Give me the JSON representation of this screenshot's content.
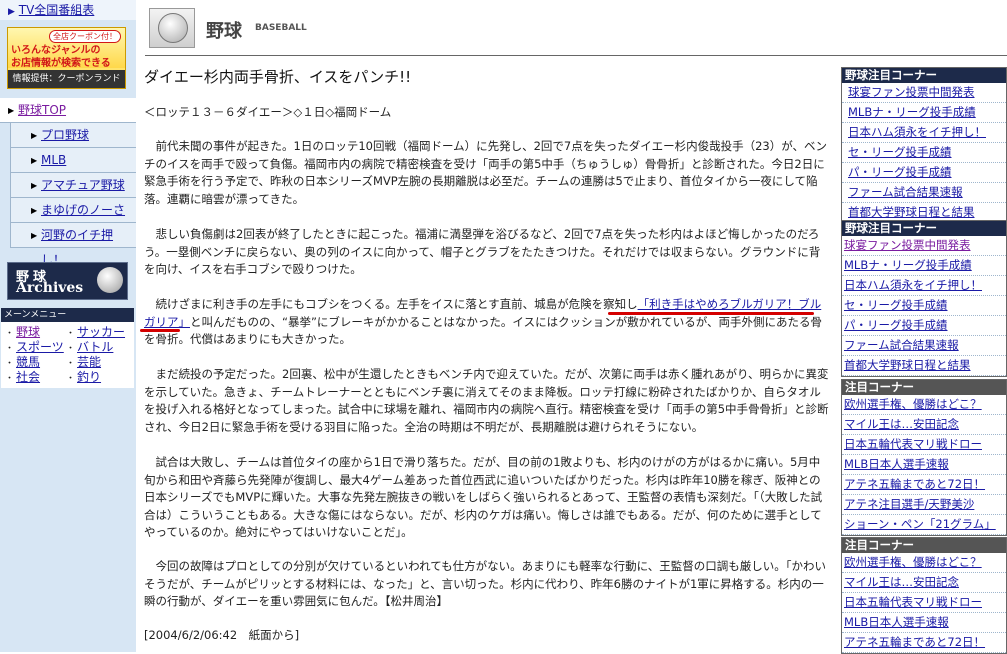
{
  "sidebar": {
    "tv_link": "TV全国番組表",
    "coupon_banner": {
      "badge": "全店クーポン付！",
      "line1": "いろんなジャンルの",
      "line2": "お店情報が検索できる",
      "footer": "情報提供：クーポンランド"
    },
    "nav": [
      {
        "label": "野球TOP"
      },
      {
        "label": "プロ野球"
      },
      {
        "label": "MLB"
      },
      {
        "label": "アマチュア野球"
      },
      {
        "label": "まゆげのノーさん"
      },
      {
        "label": "河野のイチ押し！"
      }
    ],
    "archives_banner": {
      "jp": "野球",
      "en": "Archives"
    },
    "menu_title": "メーンメニュー",
    "menu": [
      "野球",
      "サッカー",
      "スポーツ",
      "バトル",
      "競馬",
      "芸能",
      "社会",
      "釣り"
    ]
  },
  "header": {
    "title": "野球",
    "subtitle": "BASEBALL"
  },
  "article": {
    "headline": "ダイエー杉内両手骨折、イスをパンチ!!",
    "game": "＜ロッテ１３－６ダイエー＞◇１日◇福岡ドーム",
    "p1": "　前代未聞の事件が起きた。1日のロッテ10回戦（福岡ドーム）に先発し、2回で7点を失ったダイエー杉内俊哉投手（23）が、ベンチのイスを両手で殴って負傷。福岡市内の病院で精密検査を受け「両手の第5中手（ちゅうしゅ）骨骨折」と診断された。今日2日に緊急手術を行う予定で、昨秋の日本シリーズMVP左腕の長期離脱は必至だ。チームの連勝は5で止まり、首位タイから一夜にして陥落。連覇に暗雲が漂ってきた。",
    "p2": "　悲しい負傷劇は2回表が終了したときに起こった。福浦に満塁弾を浴びるなど、2回で7点を失った杉内はよほど悔しかったのだろう。一塁側ベンチに戻らない、奥の列のイスに向かって、帽子とグラブをたたきつけた。それだけでは収まらない。グラウンドに背を向け、イスを右手コブシで殴りつけた。",
    "p3_before": "　続けざまに利き手の左手にもコブシをつくる。左手をイスに落とす直前、城島が危険を察知し",
    "p3_highlight": "「利き手はやめろブルガリア！ブルガリア」",
    "p3_after": "と叫んだものの、“暴挙”にブレーキがかかることはなかった。イスにはクッションが敷かれているが、両手外側にあたる骨を骨折。代償はあまりにも大きかった。",
    "p4": "　まだ続投の予定だった。2回裏、松中が生還したときもベンチ内で迎えていた。だが、次第に両手は赤く腫れあがり、明らかに異変を示していた。急きょ、チームトレーナーとともにベンチ裏に消えてそのまま降板。ロッテ打線に粉砕されたばかりか、自らタオルを投げ入れる格好となってしまった。試合中に球場を離れ、福岡市内の病院へ直行。精密検査を受け「両手の第5中手骨骨折」と診断され、今日2日に緊急手術を受ける羽目に陥った。全治の時期は不明だが、長期離脱は避けられそうにない。",
    "p5": "　試合は大敗し、チームは首位タイの座から1日で滑り落ちた。だが、目の前の1敗よりも、杉内のけがの方がはるかに痛い。5月中旬から和田や斉藤ら先発陣が復調し、最大4ゲーム差あった首位西武に追いついたばかりだった。杉内は昨年10勝を稼ぎ、阪神との日本シリーズでもMVPに輝いた。大事な先発左腕抜きの戦いをしばらく強いられるとあって、王監督の表情も深刻だ。「（大敗した試合は）こういうこともある。大きな傷にはならない。だが、杉内のケガは痛い。悔しさは誰でもある。だが、何のために選手としてやっているのか。絶対にやってはいけないことだ」。",
    "p6": "　今回の故障はプロとしての分別が欠けているといわれても仕方がない。あまりにも軽率な行動に、王監督の口調も厳しい。「かわいそうだが、チームがピリッとする材料には、なった」と、言い切った。杉内に代わり、昨年6勝のナイトが1軍に昇格する。杉内の一瞬の行動が、ダイエーを重い雰囲気に包んだ。【松井周治】",
    "dateline": "[2004/6/2/06:42　紙面から]"
  },
  "right": {
    "box1": {
      "title": "野球注目コーナー",
      "links": [
        "球宴ファン投票中間発表",
        "MLBナ・リーグ投手成績",
        "日本ハム須永をイチ押し！",
        "セ・リーグ投手成績",
        "パ・リーグ投手成績",
        "ファーム試合結果速報",
        "首都大学野球日程と結果"
      ]
    },
    "box2": {
      "title": "野球注目コーナー",
      "links": [
        "球宴ファン投票中間発表",
        "MLBナ・リーグ投手成績",
        "日本ハム須永をイチ押し！",
        "セ・リーグ投手成績",
        "パ・リーグ投手成績",
        "ファーム試合結果速報",
        "首都大学野球日程と結果"
      ]
    },
    "box3": {
      "title": "注目コーナー",
      "links": [
        "欧州選手権、優勝はどこ？",
        "マイル王は…安田記念",
        "日本五輪代表マリ戦ドロー",
        "MLB日本人選手速報",
        "アテネ五輪まであと72日！",
        "アテネ注目選手/天野美沙",
        "ショーン・ペン「21グラム」"
      ]
    },
    "box4": {
      "title": "注目コーナー",
      "links": [
        "欧州選手権、優勝はどこ？",
        "マイル王は…安田記念",
        "日本五輪代表マリ戦ドロー",
        "MLB日本人選手速報",
        "アテネ五輪まであと72日！"
      ]
    }
  },
  "colors": {
    "sidebar_bg": "#d7e6f4",
    "header_bar": "#1d2a4a",
    "link": "#1a1aa6",
    "visited": "#7a1ca0",
    "annotation_red": "#d40000"
  }
}
